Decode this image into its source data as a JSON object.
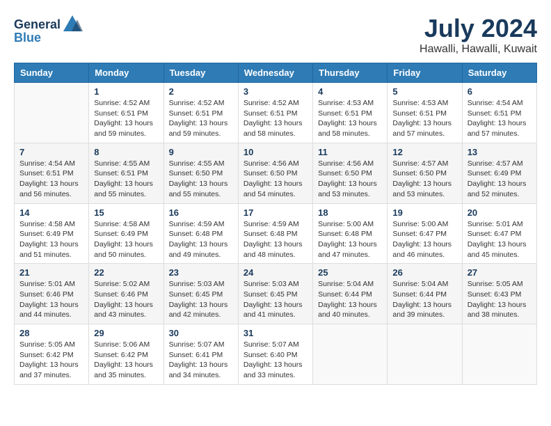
{
  "header": {
    "logo_general": "General",
    "logo_blue": "Blue",
    "month_year": "July 2024",
    "location": "Hawalli, Hawalli, Kuwait"
  },
  "days_of_week": [
    "Sunday",
    "Monday",
    "Tuesday",
    "Wednesday",
    "Thursday",
    "Friday",
    "Saturday"
  ],
  "weeks": [
    [
      {
        "day": "",
        "info": ""
      },
      {
        "day": "1",
        "info": "Sunrise: 4:52 AM\nSunset: 6:51 PM\nDaylight: 13 hours\nand 59 minutes."
      },
      {
        "day": "2",
        "info": "Sunrise: 4:52 AM\nSunset: 6:51 PM\nDaylight: 13 hours\nand 59 minutes."
      },
      {
        "day": "3",
        "info": "Sunrise: 4:52 AM\nSunset: 6:51 PM\nDaylight: 13 hours\nand 58 minutes."
      },
      {
        "day": "4",
        "info": "Sunrise: 4:53 AM\nSunset: 6:51 PM\nDaylight: 13 hours\nand 58 minutes."
      },
      {
        "day": "5",
        "info": "Sunrise: 4:53 AM\nSunset: 6:51 PM\nDaylight: 13 hours\nand 57 minutes."
      },
      {
        "day": "6",
        "info": "Sunrise: 4:54 AM\nSunset: 6:51 PM\nDaylight: 13 hours\nand 57 minutes."
      }
    ],
    [
      {
        "day": "7",
        "info": "Sunrise: 4:54 AM\nSunset: 6:51 PM\nDaylight: 13 hours\nand 56 minutes."
      },
      {
        "day": "8",
        "info": "Sunrise: 4:55 AM\nSunset: 6:51 PM\nDaylight: 13 hours\nand 55 minutes."
      },
      {
        "day": "9",
        "info": "Sunrise: 4:55 AM\nSunset: 6:50 PM\nDaylight: 13 hours\nand 55 minutes."
      },
      {
        "day": "10",
        "info": "Sunrise: 4:56 AM\nSunset: 6:50 PM\nDaylight: 13 hours\nand 54 minutes."
      },
      {
        "day": "11",
        "info": "Sunrise: 4:56 AM\nSunset: 6:50 PM\nDaylight: 13 hours\nand 53 minutes."
      },
      {
        "day": "12",
        "info": "Sunrise: 4:57 AM\nSunset: 6:50 PM\nDaylight: 13 hours\nand 53 minutes."
      },
      {
        "day": "13",
        "info": "Sunrise: 4:57 AM\nSunset: 6:49 PM\nDaylight: 13 hours\nand 52 minutes."
      }
    ],
    [
      {
        "day": "14",
        "info": "Sunrise: 4:58 AM\nSunset: 6:49 PM\nDaylight: 13 hours\nand 51 minutes."
      },
      {
        "day": "15",
        "info": "Sunrise: 4:58 AM\nSunset: 6:49 PM\nDaylight: 13 hours\nand 50 minutes."
      },
      {
        "day": "16",
        "info": "Sunrise: 4:59 AM\nSunset: 6:48 PM\nDaylight: 13 hours\nand 49 minutes."
      },
      {
        "day": "17",
        "info": "Sunrise: 4:59 AM\nSunset: 6:48 PM\nDaylight: 13 hours\nand 48 minutes."
      },
      {
        "day": "18",
        "info": "Sunrise: 5:00 AM\nSunset: 6:48 PM\nDaylight: 13 hours\nand 47 minutes."
      },
      {
        "day": "19",
        "info": "Sunrise: 5:00 AM\nSunset: 6:47 PM\nDaylight: 13 hours\nand 46 minutes."
      },
      {
        "day": "20",
        "info": "Sunrise: 5:01 AM\nSunset: 6:47 PM\nDaylight: 13 hours\nand 45 minutes."
      }
    ],
    [
      {
        "day": "21",
        "info": "Sunrise: 5:01 AM\nSunset: 6:46 PM\nDaylight: 13 hours\nand 44 minutes."
      },
      {
        "day": "22",
        "info": "Sunrise: 5:02 AM\nSunset: 6:46 PM\nDaylight: 13 hours\nand 43 minutes."
      },
      {
        "day": "23",
        "info": "Sunrise: 5:03 AM\nSunset: 6:45 PM\nDaylight: 13 hours\nand 42 minutes."
      },
      {
        "day": "24",
        "info": "Sunrise: 5:03 AM\nSunset: 6:45 PM\nDaylight: 13 hours\nand 41 minutes."
      },
      {
        "day": "25",
        "info": "Sunrise: 5:04 AM\nSunset: 6:44 PM\nDaylight: 13 hours\nand 40 minutes."
      },
      {
        "day": "26",
        "info": "Sunrise: 5:04 AM\nSunset: 6:44 PM\nDaylight: 13 hours\nand 39 minutes."
      },
      {
        "day": "27",
        "info": "Sunrise: 5:05 AM\nSunset: 6:43 PM\nDaylight: 13 hours\nand 38 minutes."
      }
    ],
    [
      {
        "day": "28",
        "info": "Sunrise: 5:05 AM\nSunset: 6:42 PM\nDaylight: 13 hours\nand 37 minutes."
      },
      {
        "day": "29",
        "info": "Sunrise: 5:06 AM\nSunset: 6:42 PM\nDaylight: 13 hours\nand 35 minutes."
      },
      {
        "day": "30",
        "info": "Sunrise: 5:07 AM\nSunset: 6:41 PM\nDaylight: 13 hours\nand 34 minutes."
      },
      {
        "day": "31",
        "info": "Sunrise: 5:07 AM\nSunset: 6:40 PM\nDaylight: 13 hours\nand 33 minutes."
      },
      {
        "day": "",
        "info": ""
      },
      {
        "day": "",
        "info": ""
      },
      {
        "day": "",
        "info": ""
      }
    ]
  ]
}
